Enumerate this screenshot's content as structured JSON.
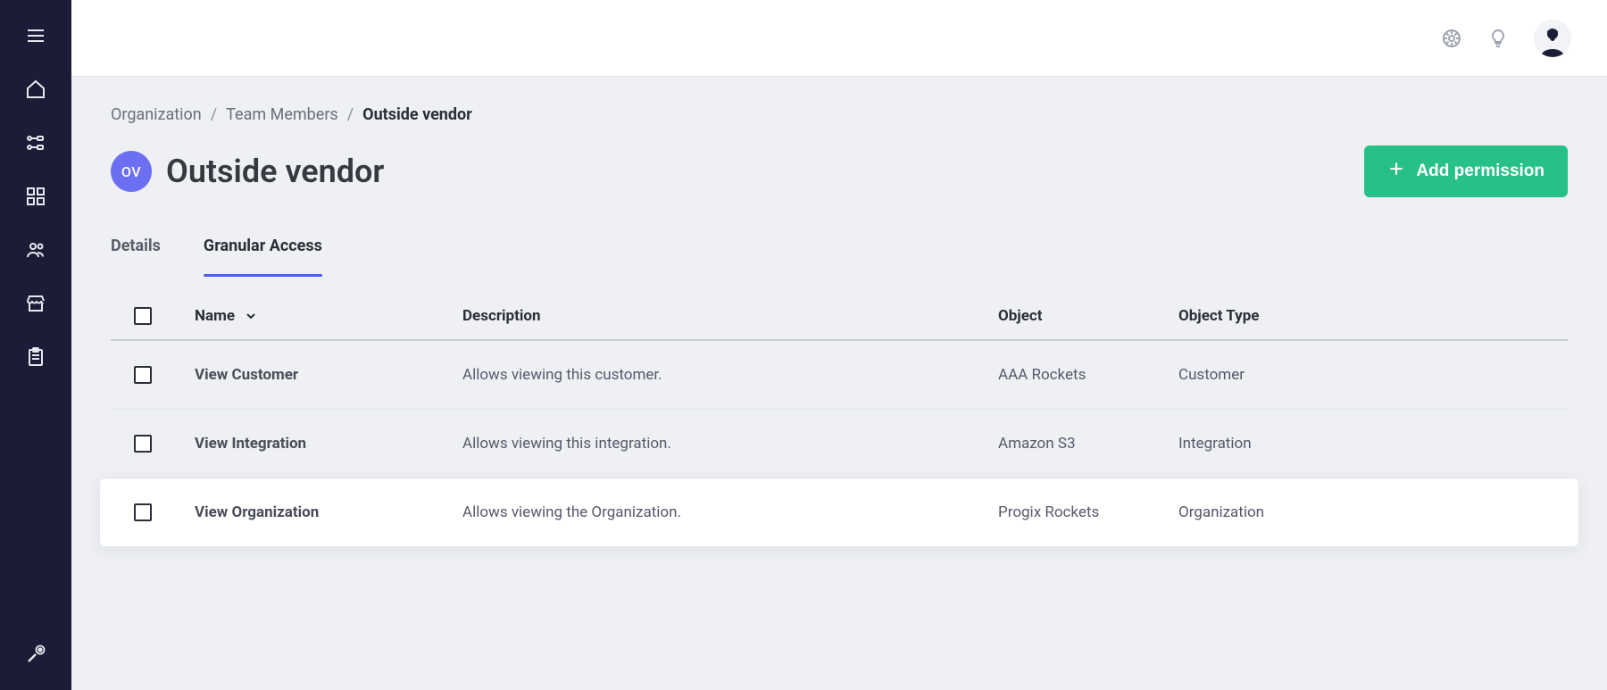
{
  "breadcrumbs": {
    "items": [
      "Organization",
      "Team Members",
      "Outside vendor"
    ]
  },
  "header": {
    "initials": "OV",
    "title": "Outside vendor",
    "add_button_label": "Add permission"
  },
  "tabs": {
    "items": [
      {
        "label": "Details",
        "active": false
      },
      {
        "label": "Granular Access",
        "active": true
      }
    ]
  },
  "table": {
    "columns": {
      "name": "Name",
      "description": "Description",
      "object": "Object",
      "objectType": "Object Type"
    },
    "rows": [
      {
        "name": "View Customer",
        "description": "Allows viewing this customer.",
        "object": "AAA Rockets",
        "objectType": "Customer",
        "highlight": false
      },
      {
        "name": "View Integration",
        "description": "Allows viewing this integration.",
        "object": "Amazon S3",
        "objectType": "Integration",
        "highlight": false
      },
      {
        "name": "View Organization",
        "description": "Allows viewing the Organization.",
        "object": "Progix Rockets",
        "objectType": "Organization",
        "highlight": true
      }
    ]
  }
}
